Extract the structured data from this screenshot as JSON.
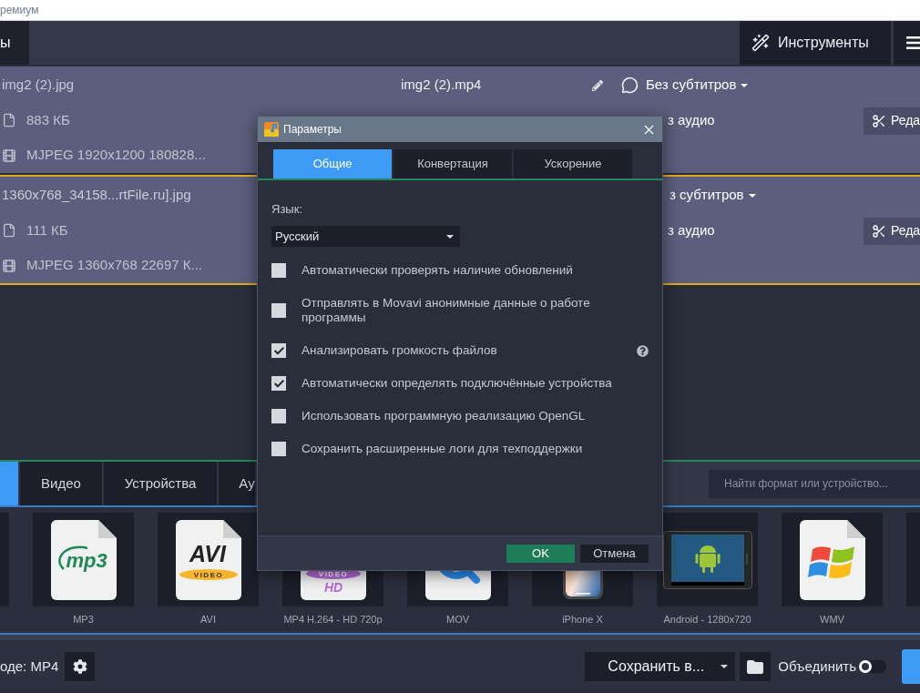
{
  "window": {
    "title": "ремиум"
  },
  "toolbar": {
    "tab": "ы",
    "tools_button": "Инструменты"
  },
  "files": [
    {
      "name": "img2 (2).jpg",
      "size": "883 КБ",
      "codec": "MJPEG 1920x1200 180828...",
      "output": "img2 (2).mp4",
      "subtitles": "Без субтитров",
      "audio": "з аудио",
      "edit": "Реда",
      "selected": false
    },
    {
      "name": "1360x768_34158...rtFile.ru].jpg",
      "size": "111 КБ",
      "codec": "MJPEG 1360x768 22697 К...",
      "subtitles": "з субтитров",
      "audio": "з аудио",
      "edit": "Реда",
      "selected": true
    }
  ],
  "formats": {
    "tabs": [
      {
        "selected": true
      },
      {
        "label": "Видео",
        "selected": false
      },
      {
        "label": "Устройства",
        "selected": false
      },
      {
        "label": "Ау",
        "selected": false
      }
    ],
    "search": {
      "placeholder": "Найти формат или устройство..."
    },
    "tiles": [
      {
        "kind": "cut"
      },
      {
        "kind": "mp3",
        "label": "MP3",
        "logo_text": "mp3"
      },
      {
        "kind": "avi",
        "label": "AVI",
        "logo_text": "AVI",
        "logo_band": "VIDEO"
      },
      {
        "kind": "mp4",
        "label": "MP4 H.264 - HD 720p",
        "logo_band": "VIDEO",
        "logo_text": "HD"
      },
      {
        "kind": "mov",
        "label": "MOV"
      },
      {
        "kind": "iphone",
        "label": "iPhone X"
      },
      {
        "kind": "android",
        "label": "Android - 1280x720"
      },
      {
        "kind": "wmv",
        "label": "WMV"
      },
      {
        "kind": "cut"
      }
    ]
  },
  "bottom_bar": {
    "output_format": "оде: MP4",
    "save_to": "Сохранить в...",
    "merge": {
      "label": "Объединить",
      "on": false
    }
  },
  "dialog": {
    "title": "Параметры",
    "tabs": [
      {
        "label": "Общие",
        "selected": true
      },
      {
        "label": "Конвертация",
        "selected": false
      },
      {
        "label": "Ускорение",
        "selected": false
      }
    ],
    "language_label": "Язык:",
    "language": "Русский",
    "options": [
      {
        "label": "Автоматически проверять наличие обновлений",
        "checked": false
      },
      {
        "label": "Отправлять в Movavi анонимные данные о работе программы",
        "checked": false
      },
      {
        "label": "Анализировать громкость файлов",
        "checked": true,
        "help": true
      },
      {
        "label": "Автоматически определять подключённые устройства",
        "checked": true
      },
      {
        "label": "Использовать программную реализацию OpenGL",
        "checked": false
      },
      {
        "label": "Сохранить расширенные логи для техподдержки",
        "checked": false
      }
    ],
    "buttons": [
      {
        "label": "OK",
        "kind": "primary"
      },
      {
        "label": "Отмена",
        "kind": "secondary"
      }
    ]
  }
}
